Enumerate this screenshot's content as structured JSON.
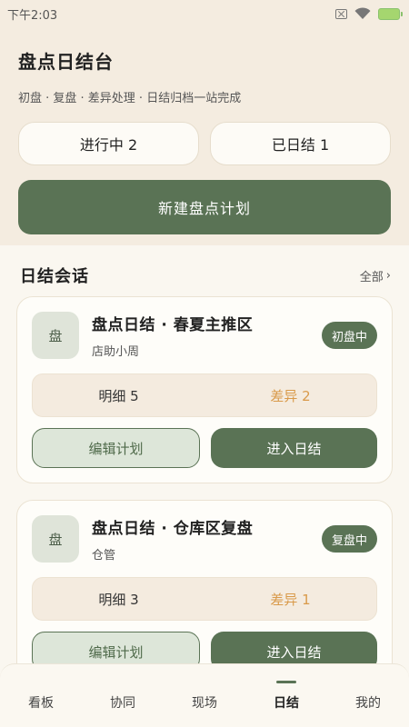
{
  "status_bar": {
    "time": "下午2:03"
  },
  "header": {
    "title": "盘点日结台",
    "subtitle": "初盘 · 复盘 · 差异处理 · 日结归档一站完成",
    "stats": [
      "进行中 2",
      "已日结 1"
    ],
    "new_plan_label": "新建盘点计划"
  },
  "section": {
    "title": "日结会话",
    "more": "全部"
  },
  "cards": [
    {
      "avatar": "盘",
      "title": "盘点日结 · 春夏主推区",
      "owner": "店助小周",
      "status": "初盘中",
      "detail": "明细 5",
      "diff": "差异 2",
      "edit_label": "编辑计划",
      "enter_label": "进入日结"
    },
    {
      "avatar": "盘",
      "title": "盘点日结 · 仓库区复盘",
      "owner": "仓管",
      "status": "复盘中",
      "detail": "明细 3",
      "diff": "差异 1",
      "edit_label": "编辑计划",
      "enter_label": "进入日结"
    }
  ],
  "nav": [
    "看板",
    "协同",
    "现场",
    "日结",
    "我的"
  ],
  "nav_active": "日结",
  "colors": {
    "primary": "#5a7355",
    "diff": "#d99a4a",
    "header_bg": "#f4ece0"
  }
}
